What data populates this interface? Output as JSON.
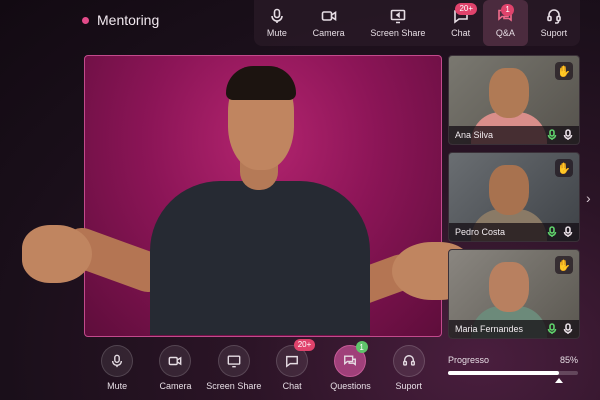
{
  "room": {
    "title": "Mentoring",
    "dot_color": "#e34b8a"
  },
  "top_toolbar": {
    "items": [
      {
        "label": "Mute",
        "icon": "mic-icon"
      },
      {
        "label": "Camera",
        "icon": "camera-icon"
      },
      {
        "label": "Screen Share",
        "icon": "screen-share-icon"
      },
      {
        "label": "Chat",
        "icon": "chat-icon",
        "badge": "20+"
      },
      {
        "label": "Q&A",
        "icon": "qa-icon",
        "badge": "1",
        "active": true
      },
      {
        "label": "Suport",
        "icon": "headset-icon"
      }
    ]
  },
  "participants": [
    {
      "name": "Ana Silva",
      "hand_raised": true,
      "mic_active": true
    },
    {
      "name": "Pedro Costa",
      "hand_raised": true,
      "mic_active": true
    },
    {
      "name": "Maria Fernandes",
      "hand_raised": true,
      "mic_active": true
    }
  ],
  "bottom_toolbar": {
    "items": [
      {
        "label": "Mute",
        "icon": "mic-icon"
      },
      {
        "label": "Camera",
        "icon": "camera-icon"
      },
      {
        "label": "Screen Share",
        "icon": "screen-share-icon"
      },
      {
        "label": "Chat",
        "icon": "chat-icon",
        "badge": "20+"
      },
      {
        "label": "Questions",
        "icon": "questions-icon",
        "badge": "1",
        "active": true
      },
      {
        "label": "Suport",
        "icon": "headset-icon"
      }
    ]
  },
  "progress": {
    "label": "Progresso",
    "value_text": "85%",
    "value": 0.85
  },
  "colors": {
    "accent": "#e0436c",
    "active_button": "#a0407a",
    "mic_on": "#5fd06b"
  }
}
